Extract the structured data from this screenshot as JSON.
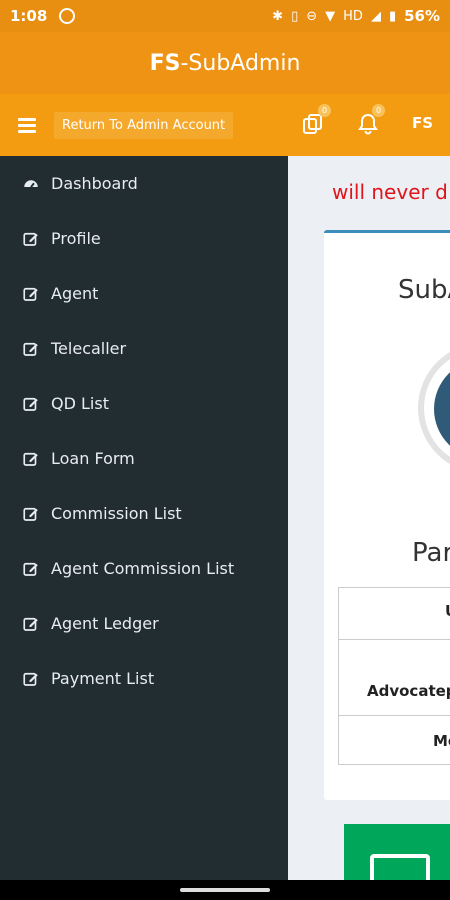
{
  "statusbar": {
    "time": "1:08",
    "battery": "56%",
    "network": "HD"
  },
  "app": {
    "title_bold": "FS",
    "title_rest": "-SubAdmin"
  },
  "toolbar": {
    "return_label": "Return To Admin Account",
    "notif1_count": "0",
    "notif2_count": "0",
    "user_initials": "FS"
  },
  "sidebar": {
    "items": [
      {
        "label": "Dashboard",
        "icon": "dashboard-icon"
      },
      {
        "label": "Profile",
        "icon": "edit-icon"
      },
      {
        "label": "Agent",
        "icon": "edit-icon"
      },
      {
        "label": "Telecaller",
        "icon": "edit-icon"
      },
      {
        "label": "QD List",
        "icon": "edit-icon"
      },
      {
        "label": "Loan Form",
        "icon": "edit-icon"
      },
      {
        "label": "Commission List",
        "icon": "edit-icon"
      },
      {
        "label": "Agent Commission List",
        "icon": "edit-icon"
      },
      {
        "label": "Agent Ledger",
        "icon": "edit-icon"
      },
      {
        "label": "Payment List",
        "icon": "edit-icon"
      }
    ]
  },
  "main": {
    "warning": "will never d",
    "card_title": "SubA",
    "card_name": "Par",
    "table": {
      "row1": "U",
      "row2": "Advocatepa",
      "row3": "Me"
    }
  },
  "colors": {
    "orange": "#f39c12",
    "sidebar": "#222d32",
    "accent_green": "#00a65a",
    "warning_red": "#e0141b"
  }
}
